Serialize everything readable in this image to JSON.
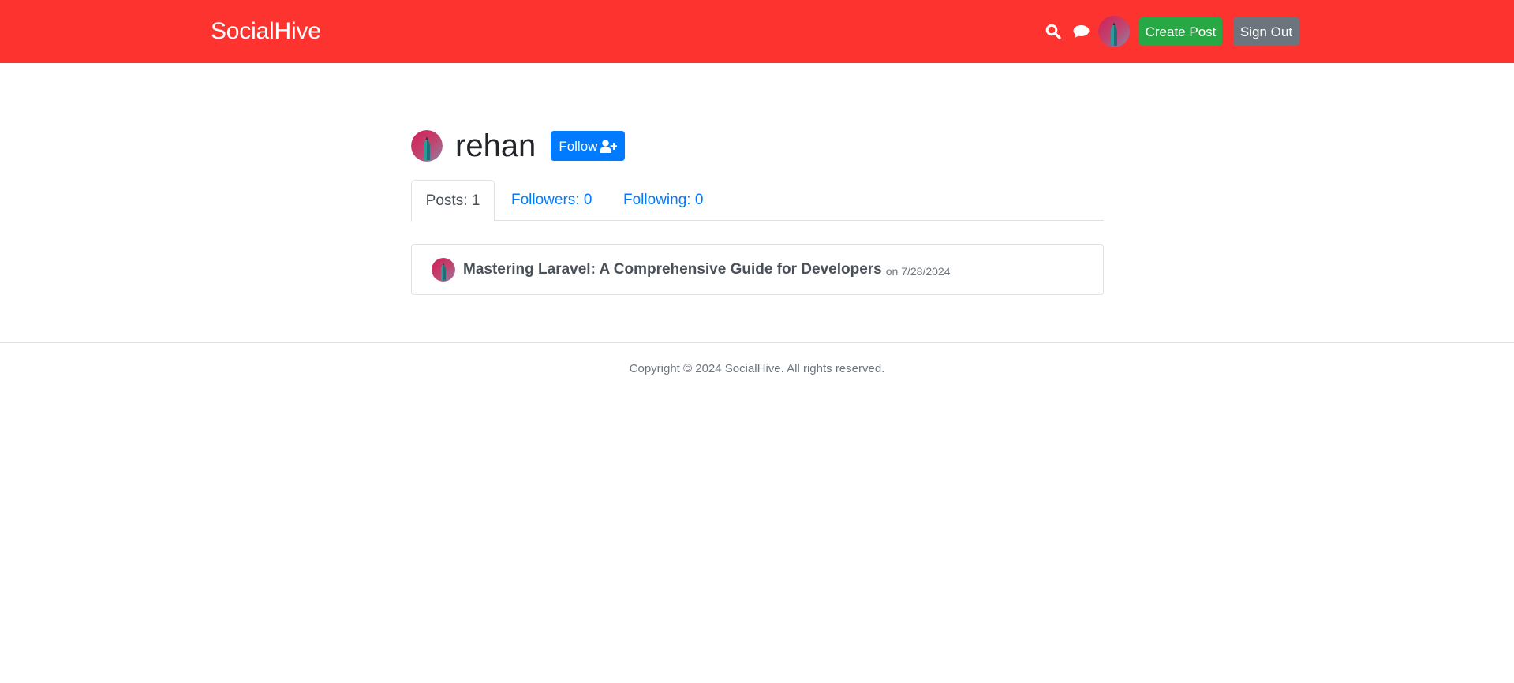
{
  "header": {
    "brand": "SocialHive",
    "create_post_label": "Create Post",
    "sign_out_label": "Sign Out",
    "icons": [
      "search-icon",
      "chat-icon"
    ]
  },
  "profile": {
    "username": "rehan",
    "follow_label": "Follow"
  },
  "tabs": [
    {
      "label": "Posts: 1",
      "active": true
    },
    {
      "label": "Followers: 0",
      "active": false
    },
    {
      "label": "Following: 0",
      "active": false
    }
  ],
  "posts": [
    {
      "title": "Mastering Laravel: A Comprehensive Guide for Developers",
      "date": "on 7/28/2024"
    }
  ],
  "footer": {
    "copyright": "Copyright © 2024 SocialHive. All rights reserved."
  },
  "colors": {
    "navbar": "#fd332f",
    "create_post": "#28a745",
    "sign_out": "#6c757d",
    "follow": "#007bff",
    "link": "#007bff"
  }
}
